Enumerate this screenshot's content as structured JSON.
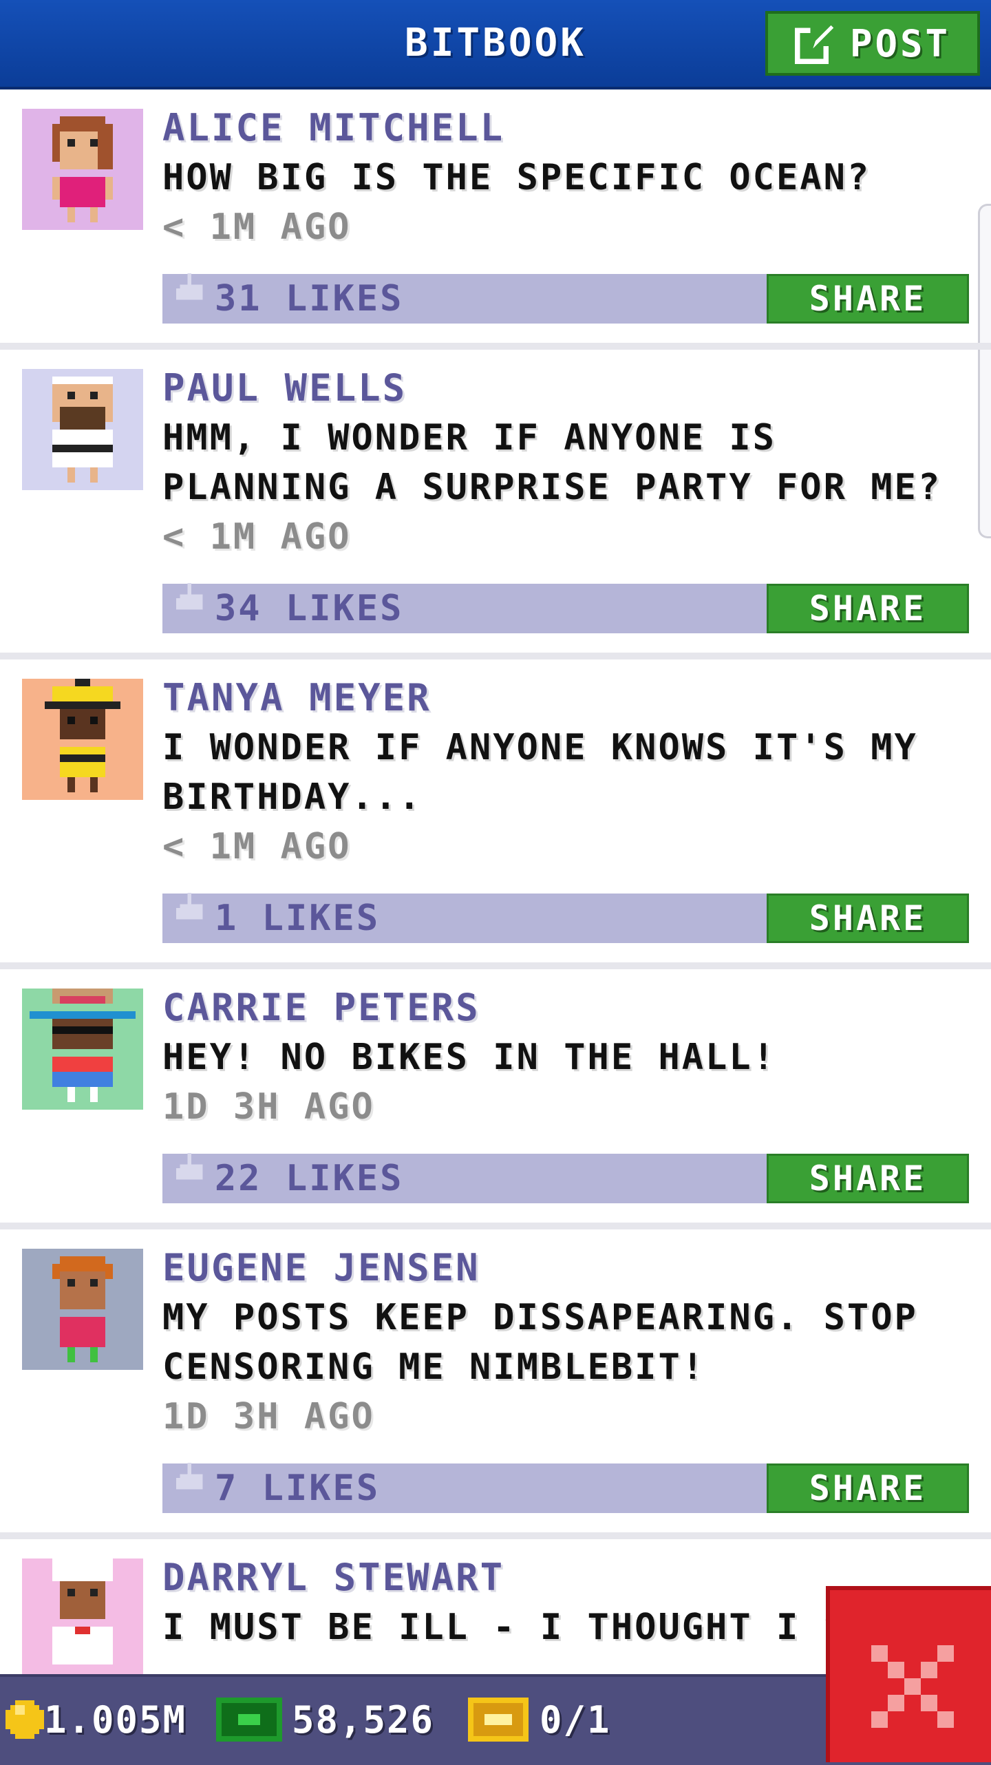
{
  "header": {
    "title": "BITBOOK",
    "post_label": "POST"
  },
  "posts": [
    {
      "author": "ALICE MITCHELL",
      "message": "HOW BIG IS THE SPECIFIC OCEAN?",
      "time": "< 1M AGO",
      "likes": "31 LIKES",
      "share": "SHARE",
      "avatar_bg": "#e0b4e8"
    },
    {
      "author": "PAUL WELLS",
      "message": "HMM, I WONDER IF ANYONE IS PLANNING A SURPRISE PARTY FOR ME?",
      "time": "< 1M AGO",
      "likes": "34 LIKES",
      "share": "SHARE",
      "avatar_bg": "#d4d4f0"
    },
    {
      "author": "TANYA MEYER",
      "message": "I WONDER IF ANYONE KNOWS IT'S MY BIRTHDAY...",
      "time": "< 1M AGO",
      "likes": "1 LIKES",
      "share": "SHARE",
      "avatar_bg": "#f7b28a"
    },
    {
      "author": "CARRIE PETERS",
      "message": "HEY! NO BIKES IN THE HALL!",
      "time": "1D 3H AGO",
      "likes": "22 LIKES",
      "share": "SHARE",
      "avatar_bg": "#8ed8a6"
    },
    {
      "author": "EUGENE JENSEN",
      "message": "MY POSTS KEEP DISSAPEARING. STOP CENSORING ME NIMBLEBIT!",
      "time": "1D 3H AGO",
      "likes": "7 LIKES",
      "share": "SHARE",
      "avatar_bg": "#9ea8c0"
    },
    {
      "author": "DARRYL STEWART",
      "message": "I MUST BE ILL - I THOUGHT I SAW",
      "time": "",
      "likes": "",
      "share": "",
      "avatar_bg": "#f4bce4"
    }
  ],
  "bottom_bar": {
    "coins": "1.005M",
    "bux": "58,526",
    "tickets": "0/1"
  },
  "icons": {
    "post": "compose-icon",
    "like": "thumbs-up-icon",
    "coin": "coin-icon",
    "bux": "bux-icon",
    "ticket": "golden-ticket-icon",
    "close": "close-icon"
  },
  "colors": {
    "header": "#1550b8",
    "share_green": "#3aa035",
    "like_bar": "#b5b5d8",
    "author": "#5b579a",
    "close_red": "#e0242c",
    "bottom_bar": "#4e4e7e"
  }
}
